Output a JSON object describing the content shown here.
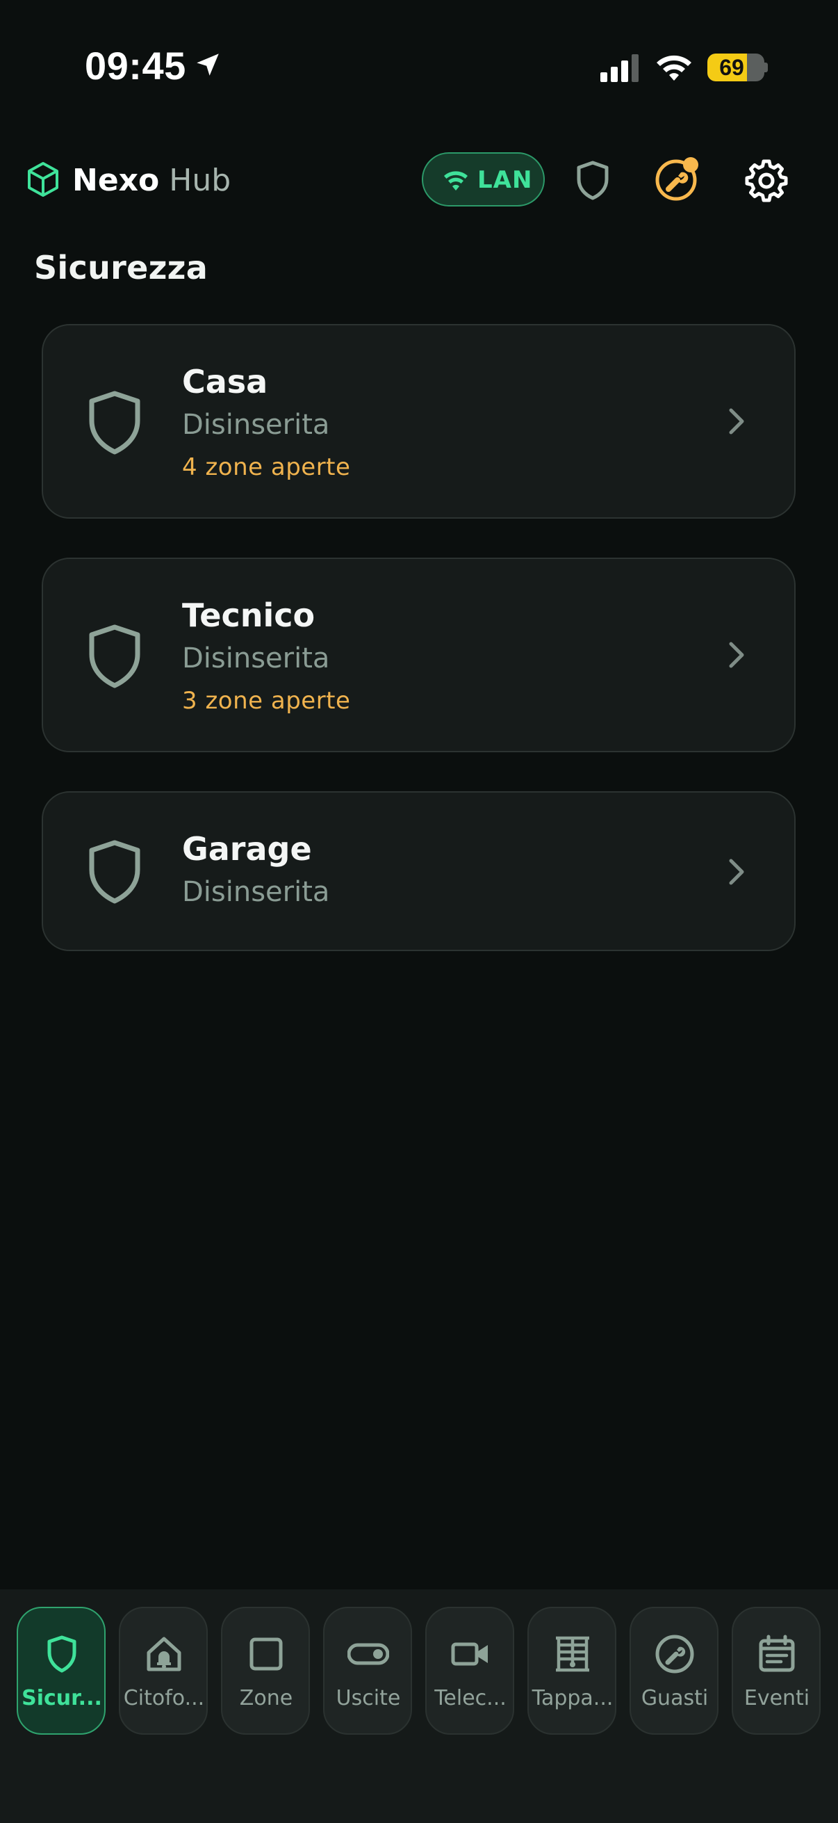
{
  "status_bar": {
    "time": "09:45",
    "battery_level": "69",
    "battery_fraction": 0.69
  },
  "header": {
    "brand_bold": "Nexo",
    "brand_light": "Hub",
    "connection_label": "LAN"
  },
  "section": {
    "title": "Sicurezza"
  },
  "areas": [
    {
      "name": "Casa",
      "status": "Disinserita",
      "zones": "4 zone aperte"
    },
    {
      "name": "Tecnico",
      "status": "Disinserita",
      "zones": "3 zone aperte"
    },
    {
      "name": "Garage",
      "status": "Disinserita",
      "zones": ""
    }
  ],
  "nav": [
    {
      "label": "Sicur...",
      "icon": "shield-icon",
      "active": true
    },
    {
      "label": "Citofo...",
      "icon": "intercom-icon",
      "active": false
    },
    {
      "label": "Zone",
      "icon": "square-icon",
      "active": false
    },
    {
      "label": "Uscite",
      "icon": "toggle-icon",
      "active": false
    },
    {
      "label": "Telec...",
      "icon": "video-camera-icon",
      "active": false
    },
    {
      "label": "Tappa...",
      "icon": "shutter-icon",
      "active": false
    },
    {
      "label": "Guasti",
      "icon": "wrench-icon",
      "active": false
    },
    {
      "label": "Eventi",
      "icon": "calendar-icon",
      "active": false
    }
  ],
  "colors": {
    "background": "#0b0f0e",
    "accent_green": "#3fe29a",
    "warning_orange": "#f0b34e",
    "battery_yellow": "#f4cb15"
  }
}
